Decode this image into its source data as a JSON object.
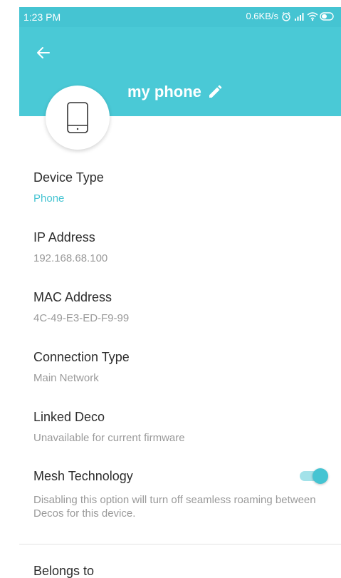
{
  "status_bar": {
    "time": "1:23 PM",
    "network_speed": "0.6KB/s",
    "icons": [
      "alarm-icon",
      "signal-icon",
      "wifi-icon",
      "battery-icon"
    ]
  },
  "header": {
    "device_name": "my phone",
    "device_icon": "phone-icon",
    "colors": {
      "header_bg": "#4ac9d6",
      "status_bg": "#45c4d2",
      "accent": "#45c4d2"
    }
  },
  "details": {
    "device_type": {
      "label": "Device Type",
      "value": "Phone"
    },
    "ip_address": {
      "label": "IP Address",
      "value": "192.168.68.100"
    },
    "mac_address": {
      "label": "MAC Address",
      "value": "4C-49-E3-ED-F9-99"
    },
    "connection_type": {
      "label": "Connection Type",
      "value": "Main Network"
    },
    "linked_deco": {
      "label": "Linked Deco",
      "value": "Unavailable for current firmware"
    },
    "mesh": {
      "label": "Mesh Technology",
      "enabled": true,
      "description": "Disabling this option will turn off seamless roaming between Decos for this device."
    },
    "belongs_to": {
      "label": "Belongs to"
    }
  }
}
